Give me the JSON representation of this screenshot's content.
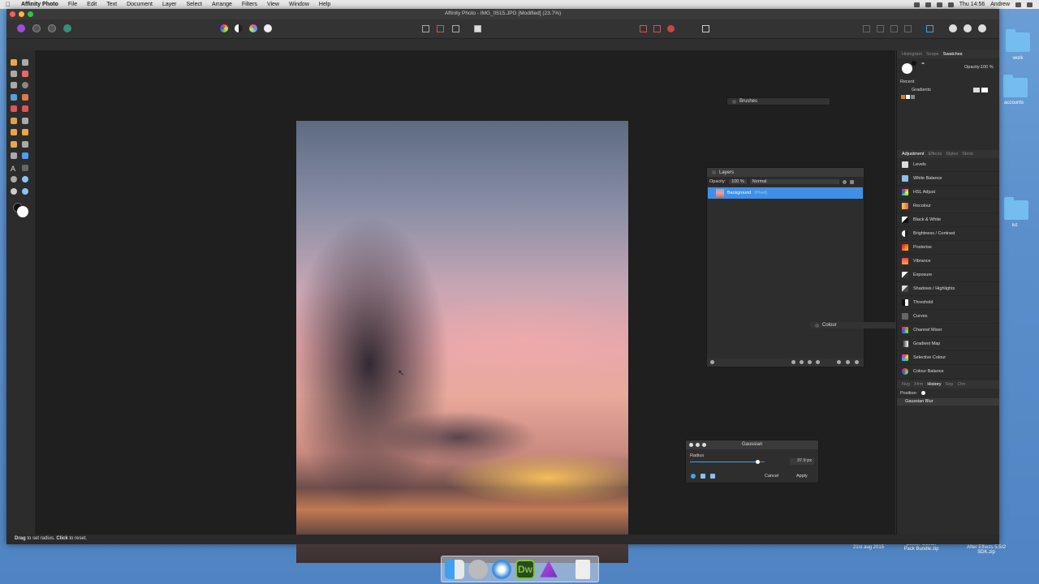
{
  "menubar": {
    "app_name": "Affinity Photo",
    "items": [
      "File",
      "Edit",
      "Text",
      "Document",
      "Layer",
      "Select",
      "Arrange",
      "Filters",
      "View",
      "Window",
      "Help"
    ],
    "clock": "Thu 14:56",
    "user": "Andrew"
  },
  "window": {
    "title": "Affinity Photo - IMG_0515.JPG [Modified] (23.7%)"
  },
  "status": {
    "hint_bold1": "Drag",
    "hint_text1": " to set radius. ",
    "hint_bold2": "Click",
    "hint_text2": " to reset."
  },
  "brushes_panel": {
    "title": "Brushes"
  },
  "colour_panel": {
    "title": "Colour"
  },
  "layers_panel": {
    "title": "Layers",
    "opacity_label": "Opacity:",
    "opacity_value": "100 %",
    "blend_mode": "Normal",
    "layer_name": "Background",
    "layer_tag": "(Pixel)"
  },
  "studio": {
    "top_tabs": [
      "Histogram",
      "Scope",
      "Swatches"
    ],
    "active_top_tab": "Swatches",
    "opacity_label": "Opacity:",
    "opacity_value": "100 %",
    "recent_label": "Recent",
    "gradients_label": "Gradients",
    "adj_tabs": [
      "Adjustment",
      "Effects",
      "Styles",
      "Stock"
    ],
    "adjustments": [
      "Levels",
      "White Balance",
      "HSL Adjust",
      "Recolour",
      "Black & White",
      "Brightness / Contrast",
      "Posterise",
      "Vibrance",
      "Exposure",
      "Shadows / Highlights",
      "Threshold",
      "Curves",
      "Channel Mixer",
      "Gradient Map",
      "Selective Colour",
      "Colour Balance"
    ],
    "history_tabs": [
      "Nvg",
      "Xfrm",
      "History",
      "Snp",
      "Chn"
    ],
    "position_label": "Position:",
    "history_item": "Gaussian Blur"
  },
  "gaussian_dialog": {
    "title": "Gaussian",
    "radius_label": "Radius",
    "radius_value": "37.9 px",
    "radius_fraction": 0.9,
    "cancel_label": "Cancel",
    "apply_label": "Apply"
  },
  "desktop": {
    "folders": [
      "work",
      "accounts",
      "iut"
    ],
    "date_text": "21st aug 2015",
    "files": [
      "poster-Ocean Pack Bundle.zip",
      "After Effects 5.5r2 SDK.zip"
    ]
  },
  "colors": {
    "accent_blue": "#4a9ff0",
    "layer_selected": "#3f8fe6",
    "affinity_purple": "#9b4fd9"
  },
  "icons": {
    "dock": [
      "finder-icon",
      "launchpad-icon",
      "safari-icon",
      "dreamweaver-icon",
      "affinity-photo-icon",
      "trash-icon"
    ]
  },
  "dock_labels": {
    "dreamweaver": "Dw"
  }
}
